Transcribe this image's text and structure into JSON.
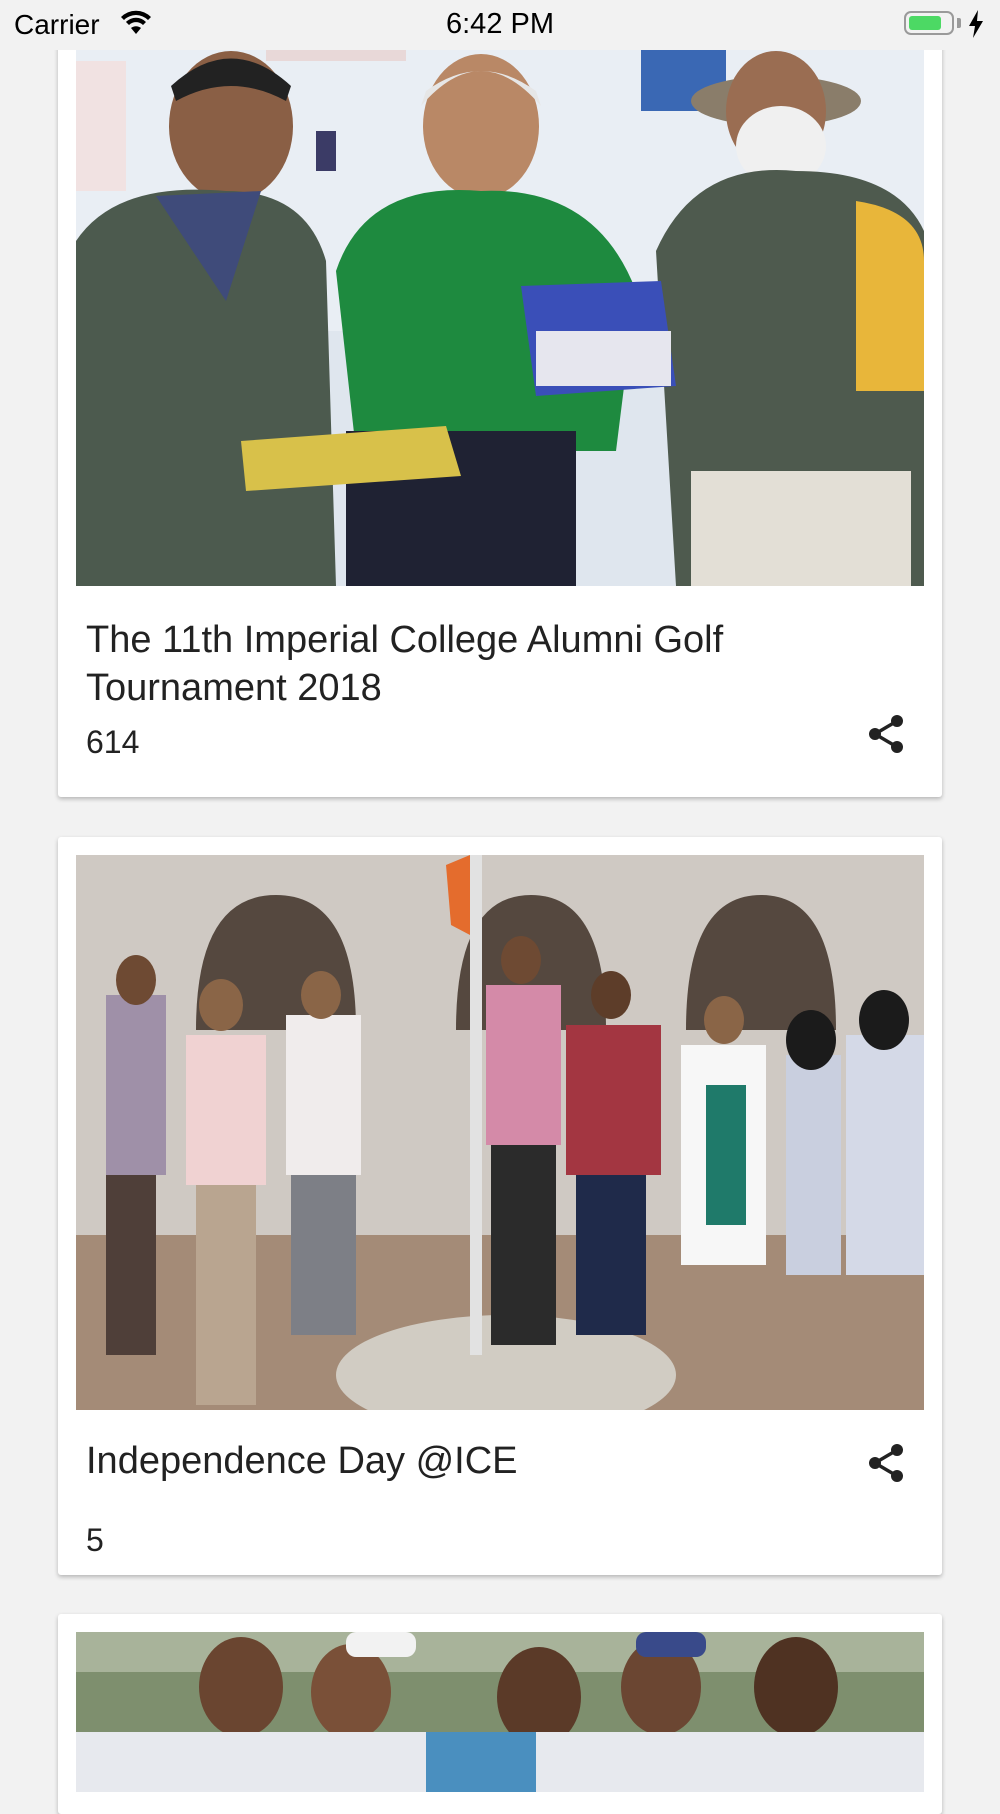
{
  "status_bar": {
    "carrier": "Carrier",
    "time": "6:42 PM",
    "battery_level": 0.8,
    "battery_color": "#4cd964"
  },
  "feed": {
    "items": [
      {
        "title": "The 11th Imperial College Alumni Golf Tournament 2018",
        "count": "614",
        "image": "golf-tournament-prize-photo",
        "share_icon": "share-icon"
      },
      {
        "title": "Independence Day @ICE",
        "count": "5",
        "image": "flag-hoisting-photo",
        "share_icon": "share-icon"
      },
      {
        "title": "",
        "count": "",
        "image": "group-students-photo",
        "share_icon": ""
      }
    ]
  }
}
